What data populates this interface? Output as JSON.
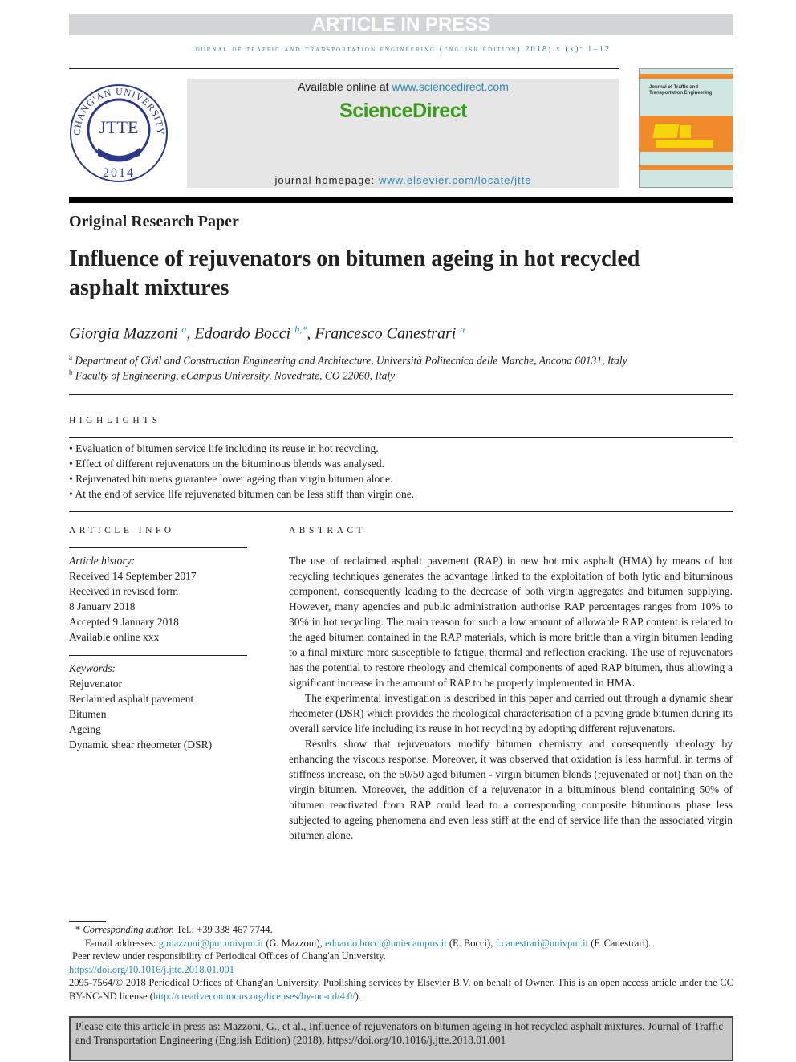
{
  "banner": "ARTICLE IN PRESS",
  "journal_line": "journal of traffic and transportation engineering (english edition) 2018; x (x): 1–12",
  "logo": {
    "top_text": "CHANG'AN UNIVERSITY",
    "center": "JTTE",
    "year": "2014"
  },
  "sd": {
    "available_prefix": "Available online at ",
    "available_link": "www.sciencedirect.com",
    "brand": "ScienceDirect",
    "homepage_prefix": "journal homepage: ",
    "homepage_link": "www.elsevier.com/locate/jtte"
  },
  "cover": {
    "title": "Journal of Traffic and Transportation Engineering"
  },
  "paper_type": "Original Research Paper",
  "title": "Influence of rejuvenators on bitumen ageing in hot recycled asphalt mixtures",
  "authors": [
    {
      "name": "Giorgia Mazzoni",
      "sup": "a"
    },
    {
      "name": "Edoardo Bocci",
      "sup": "b,*"
    },
    {
      "name": "Francesco Canestrari",
      "sup": "a"
    }
  ],
  "affiliations": [
    {
      "sup": "a",
      "text": "Department of Civil and Construction Engineering and Architecture, Università Politecnica delle Marche, Ancona 60131, Italy"
    },
    {
      "sup": "b",
      "text": "Faculty of Engineering, eCampus University, Novedrate, CO 22060, Italy"
    }
  ],
  "highlights": {
    "heading": "HIGHLIGHTS",
    "items": [
      "Evaluation of bitumen service life including its reuse in hot recycling.",
      "Effect of different rejuvenators on the bituminous blends was analysed.",
      "Rejuvenated bitumens guarantee lower ageing than virgin bitumen alone.",
      "At the end of service life rejuvenated bitumen can be less stiff than virgin one."
    ]
  },
  "article_info": {
    "heading": "ARTICLE INFO",
    "history_label": "Article history:",
    "history": [
      "Received 14 September 2017",
      "Received in revised form",
      "8 January 2018",
      "Accepted 9 January 2018",
      "Available online xxx"
    ],
    "keywords_label": "Keywords:",
    "keywords": [
      "Rejuvenator",
      "Reclaimed asphalt pavement",
      "Bitumen",
      "Ageing",
      "Dynamic shear rheometer (DSR)"
    ]
  },
  "abstract": {
    "heading": "ABSTRACT",
    "paragraphs": [
      "The use of reclaimed asphalt pavement (RAP) in new hot mix asphalt (HMA) by means of hot recycling techniques generates the advantage linked to the exploitation of both lytic and bituminous component, consequently leading to the decrease of both virgin aggregates and bitumen supplying. However, many agencies and public administration authorise RAP percentages ranges from 10% to 30% in hot recycling. The main reason for such a low amount of allowable RAP content is related to the aged bitumen contained in the RAP materials, which is more brittle than a virgin bitumen leading to a final mixture more susceptible to fatigue, thermal and reflection cracking. The use of rejuvenators has the potential to restore rheology and chemical components of aged RAP bitumen, thus allowing a significant increase in the amount of RAP to be properly implemented in HMA.",
      "The experimental investigation is described in this paper and carried out through a dynamic shear rheometer (DSR) which provides the rheological characterisation of a paving grade bitumen during its overall service life including its reuse in hot recycling by adopting different rejuvenators.",
      "Results show that rejuvenators modify bitumen chemistry and consequently rheology by enhancing the viscous response. Moreover, it was observed that oxidation is less harmful, in terms of stiffness increase, on the 50/50 aged bitumen - virgin bitumen blends (rejuvenated or not) than on the virgin bitumen. Moreover, the addition of a rejuvenator in a bituminous blend containing 50% of bitumen reactivated from RAP could lead to a corresponding composite bituminous phase less subjected to ageing phenomena and even less stiff at the end of service life than the associated virgin bitumen alone."
    ]
  },
  "footnotes": {
    "corr_label": "Corresponding author.",
    "corr_tel": " Tel.: +39 338 467 7744.",
    "email_label": "E-mail addresses: ",
    "emails": [
      {
        "addr": "g.mazzoni@pm.univpm.it",
        "who": " (G. Mazzoni), "
      },
      {
        "addr": "edoardo.bocci@uniecampus.it",
        "who": " (E. Bocci), "
      },
      {
        "addr": "f.canestrari@univpm.it",
        "who": " (F. Canestrari)."
      }
    ],
    "peer": "Peer review under responsibility of Periodical Offices of Chang'an University.",
    "doi": "https://doi.org/10.1016/j.jtte.2018.01.001",
    "copyright": "2095-7564/© 2018 Periodical Offices of Chang'an University. Publishing services by Elsevier B.V. on behalf of Owner. This is an open access article under the CC BY-NC-ND license (",
    "license_link": "http://creativecommons.org/licenses/by-nc-nd/4.0/",
    "copyright_end": ")."
  },
  "cite": "Please cite this article in press as: Mazzoni, G., et al., Influence of rejuvenators on bitumen ageing in hot recycled asphalt mixtures, Journal of Traffic and Transportation Engineering (English Edition) (2018), https://doi.org/10.1016/j.jtte.2018.01.001"
}
